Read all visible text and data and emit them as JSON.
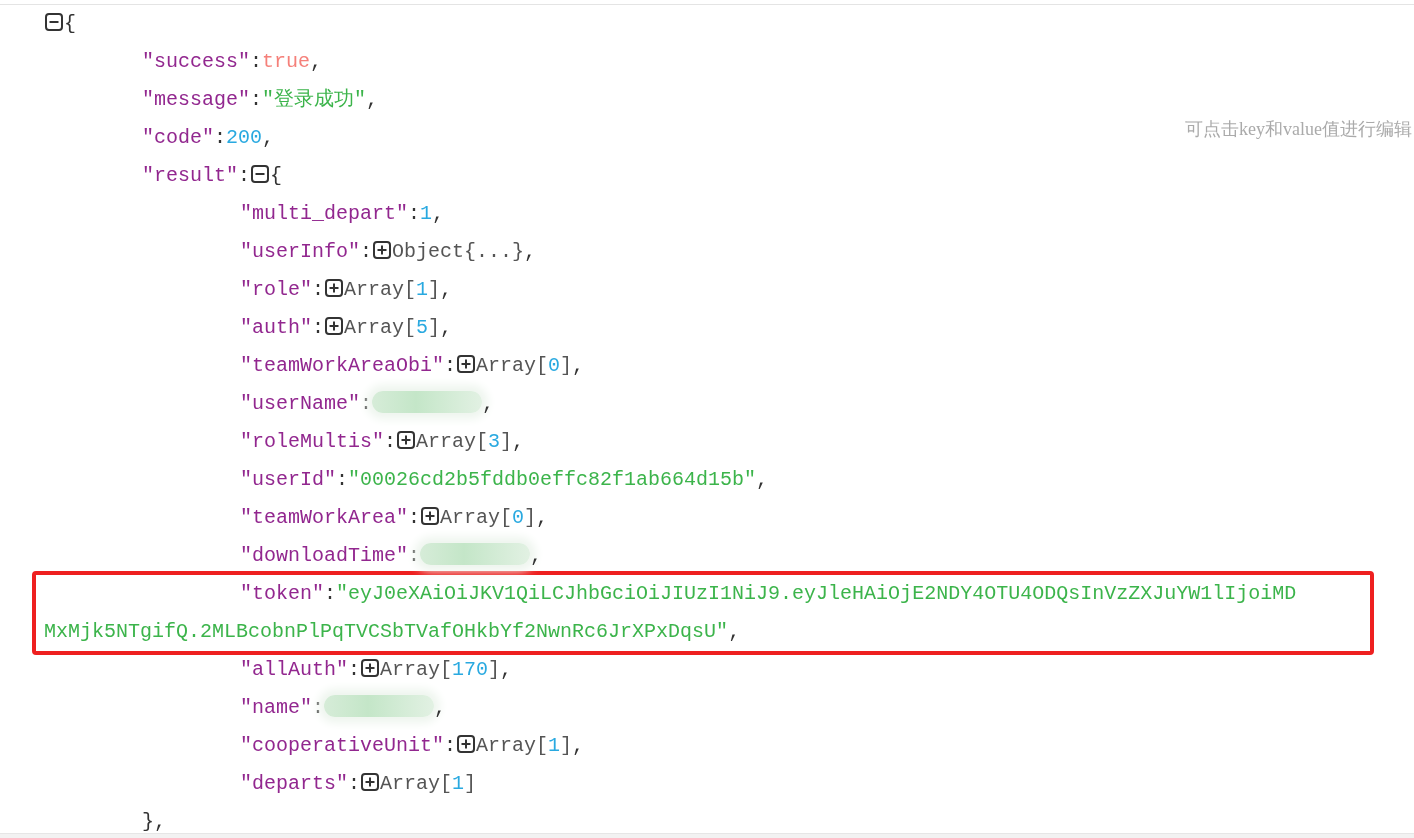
{
  "hint": "可点击key和value值进行编辑",
  "root": {
    "expanded": true,
    "tokens": [
      {
        "kind": "toggle"
      },
      {
        "kind": "punct",
        "text": "{"
      }
    ],
    "children": [
      {
        "tokens": [
          {
            "kind": "key",
            "text": "\"success\""
          },
          {
            "kind": "punct",
            "text": ":"
          },
          {
            "kind": "boolean",
            "text": "true"
          },
          {
            "kind": "punct",
            "text": ","
          }
        ]
      },
      {
        "tokens": [
          {
            "kind": "key",
            "text": "\"message\""
          },
          {
            "kind": "punct",
            "text": ":"
          },
          {
            "kind": "string",
            "text": "\"登录成功\""
          },
          {
            "kind": "punct",
            "text": ","
          }
        ]
      },
      {
        "tokens": [
          {
            "kind": "key",
            "text": "\"code\""
          },
          {
            "kind": "punct",
            "text": ":"
          },
          {
            "kind": "number",
            "text": "200"
          },
          {
            "kind": "punct",
            "text": ","
          }
        ]
      },
      {
        "expanded": true,
        "tokens": [
          {
            "kind": "key",
            "text": "\"result\""
          },
          {
            "kind": "punct",
            "text": ":"
          },
          {
            "kind": "toggle"
          },
          {
            "kind": "punct",
            "text": "{"
          }
        ],
        "closing": [
          {
            "kind": "punct",
            "text": "},"
          }
        ],
        "children": [
          {
            "tokens": [
              {
                "kind": "key",
                "text": "\"multi_depart\""
              },
              {
                "kind": "punct",
                "text": ":"
              },
              {
                "kind": "number",
                "text": "1"
              },
              {
                "kind": "punct",
                "text": ","
              }
            ]
          },
          {
            "expanded": false,
            "tokens": [
              {
                "kind": "key",
                "text": "\"userInfo\""
              },
              {
                "kind": "punct",
                "text": ":"
              },
              {
                "kind": "toggle"
              },
              {
                "kind": "type",
                "text": "Object{...}"
              },
              {
                "kind": "punct",
                "text": ","
              }
            ]
          },
          {
            "expanded": false,
            "tokens": [
              {
                "kind": "key",
                "text": "\"role\""
              },
              {
                "kind": "punct",
                "text": ":"
              },
              {
                "kind": "toggle"
              },
              {
                "kind": "type",
                "text": "Array["
              },
              {
                "kind": "number",
                "text": "1"
              },
              {
                "kind": "type",
                "text": "]"
              },
              {
                "kind": "punct",
                "text": ","
              }
            ]
          },
          {
            "expanded": false,
            "tokens": [
              {
                "kind": "key",
                "text": "\"auth\""
              },
              {
                "kind": "punct",
                "text": ":"
              },
              {
                "kind": "toggle"
              },
              {
                "kind": "type",
                "text": "Array["
              },
              {
                "kind": "number",
                "text": "5"
              },
              {
                "kind": "type",
                "text": "]"
              },
              {
                "kind": "punct",
                "text": ","
              }
            ]
          },
          {
            "expanded": false,
            "tokens": [
              {
                "kind": "key",
                "text": "\"teamWorkAreaObi\""
              },
              {
                "kind": "punct",
                "text": ":"
              },
              {
                "kind": "toggle"
              },
              {
                "kind": "type",
                "text": "Array["
              },
              {
                "kind": "number",
                "text": "0"
              },
              {
                "kind": "type",
                "text": "]"
              },
              {
                "kind": "punct",
                "text": ","
              }
            ]
          },
          {
            "tokens": [
              {
                "kind": "key",
                "text": "\"userName\""
              },
              {
                "kind": "punct",
                "text": ":"
              },
              {
                "kind": "redacted"
              },
              {
                "kind": "punct",
                "text": ","
              }
            ]
          },
          {
            "expanded": false,
            "tokens": [
              {
                "kind": "key",
                "text": "\"roleMultis\""
              },
              {
                "kind": "punct",
                "text": ":"
              },
              {
                "kind": "toggle"
              },
              {
                "kind": "type",
                "text": "Array["
              },
              {
                "kind": "number",
                "text": "3"
              },
              {
                "kind": "type",
                "text": "]"
              },
              {
                "kind": "punct",
                "text": ","
              }
            ]
          },
          {
            "tokens": [
              {
                "kind": "key",
                "text": "\"userId\""
              },
              {
                "kind": "punct",
                "text": ":"
              },
              {
                "kind": "string",
                "text": "\"00026cd2b5fddb0effc82f1ab664d15b\""
              },
              {
                "kind": "punct",
                "text": ","
              }
            ]
          },
          {
            "expanded": false,
            "tokens": [
              {
                "kind": "key",
                "text": "\"teamWorkArea\""
              },
              {
                "kind": "punct",
                "text": ":"
              },
              {
                "kind": "toggle"
              },
              {
                "kind": "type",
                "text": "Array["
              },
              {
                "kind": "number",
                "text": "0"
              },
              {
                "kind": "type",
                "text": "]"
              },
              {
                "kind": "punct",
                "text": ","
              }
            ]
          },
          {
            "tokens": [
              {
                "kind": "key",
                "text": "\"downloadTime\""
              },
              {
                "kind": "punct",
                "text": ":"
              },
              {
                "kind": "redacted"
              },
              {
                "kind": "punct",
                "text": ","
              }
            ]
          },
          {
            "highlighted": true,
            "tokens": [
              {
                "kind": "key",
                "text": "\"token\""
              },
              {
                "kind": "punct",
                "text": ":"
              },
              {
                "kind": "string",
                "text": "\"eyJ0eXAiOiJKV1QiLCJhbGciOiJIUzI1NiJ9.eyJleHAiOjE2NDY4OTU4ODQsInVzZXJuYW1lIjoiMD"
              },
              {
                "kind": "break"
              },
              {
                "kind": "string",
                "text": "MxMjk5NTgifQ.2MLBcobnPlPqTVCSbTVafOHkbYf2NwnRc6JrXPxDqsU\""
              },
              {
                "kind": "punct",
                "text": ","
              }
            ]
          },
          {
            "expanded": false,
            "tokens": [
              {
                "kind": "key",
                "text": "\"allAuth\""
              },
              {
                "kind": "punct",
                "text": ":"
              },
              {
                "kind": "toggle"
              },
              {
                "kind": "type",
                "text": "Array["
              },
              {
                "kind": "number",
                "text": "170"
              },
              {
                "kind": "type",
                "text": "]"
              },
              {
                "kind": "punct",
                "text": ","
              }
            ]
          },
          {
            "tokens": [
              {
                "kind": "key",
                "text": "\"name\""
              },
              {
                "kind": "punct",
                "text": ":"
              },
              {
                "kind": "redacted"
              },
              {
                "kind": "punct",
                "text": ","
              }
            ]
          },
          {
            "expanded": false,
            "tokens": [
              {
                "kind": "key",
                "text": "\"cooperativeUnit\""
              },
              {
                "kind": "punct",
                "text": ":"
              },
              {
                "kind": "toggle"
              },
              {
                "kind": "type",
                "text": "Array["
              },
              {
                "kind": "number",
                "text": "1"
              },
              {
                "kind": "type",
                "text": "]"
              },
              {
                "kind": "punct",
                "text": ","
              }
            ]
          },
          {
            "expanded": false,
            "tokens": [
              {
                "kind": "key",
                "text": "\"departs\""
              },
              {
                "kind": "punct",
                "text": ":"
              },
              {
                "kind": "toggle"
              },
              {
                "kind": "type",
                "text": "Array["
              },
              {
                "kind": "number",
                "text": "1"
              },
              {
                "kind": "type",
                "text": "]"
              }
            ]
          }
        ]
      }
    ]
  }
}
